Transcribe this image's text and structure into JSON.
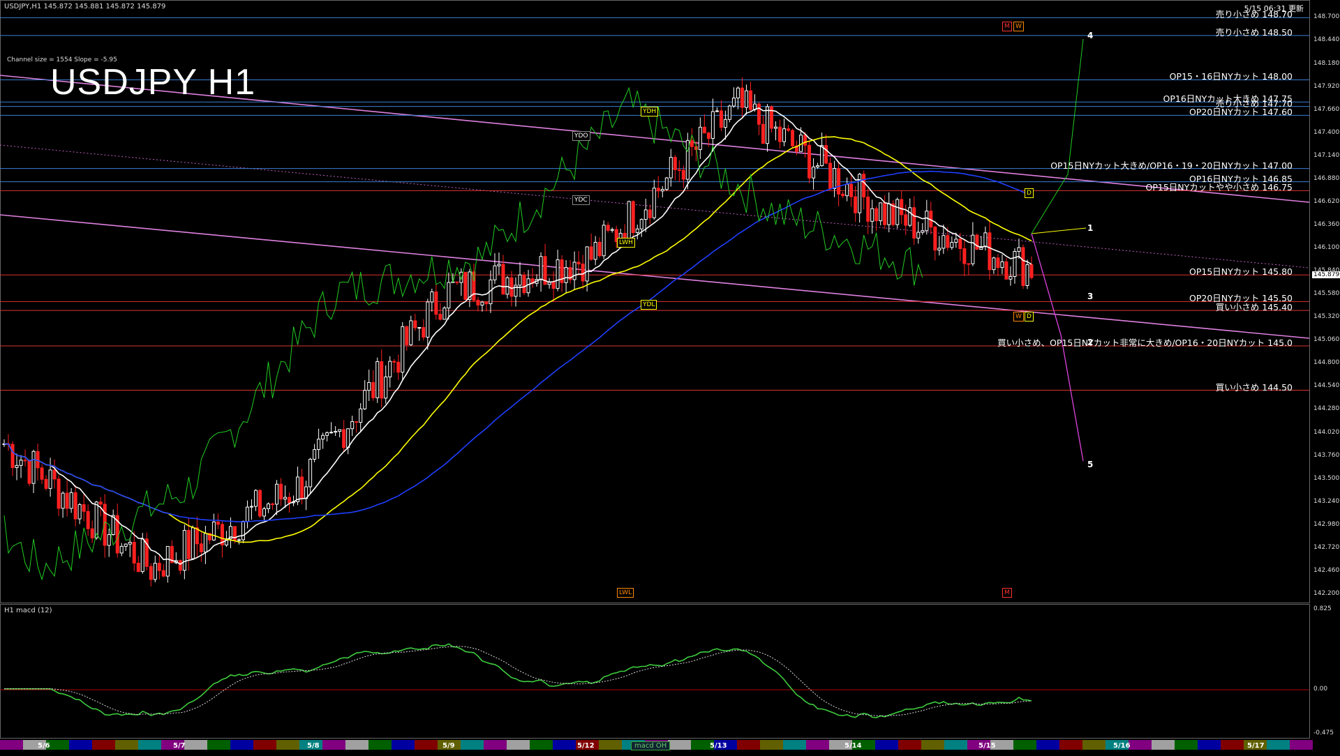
{
  "header": {
    "symbol_info": "USDJPY,H1  145.872 145.881 145.872 145.879",
    "channel_info": "Channel size = 1554 Slope = -5.95",
    "big_title": "USDJPY H1",
    "updated": "5/15 06:31 更新",
    "current_price": "145.879"
  },
  "macd_panel": {
    "label": "H1  macd (12)",
    "button": "macd OH",
    "scale": [
      "0.825",
      "0.00",
      "-0.475"
    ],
    "zero": "0.00"
  },
  "dates": [
    "5/6",
    "5/7",
    "5/8",
    "5/9",
    "5/12",
    "5/13",
    "5/14",
    "5/15",
    "5/16",
    "5/17"
  ],
  "price_scale": [
    "148.700",
    "148.440",
    "148.180",
    "147.920",
    "147.660",
    "147.400",
    "147.140",
    "146.880",
    "146.620",
    "146.360",
    "146.100",
    "145.840",
    "145.580",
    "145.320",
    "145.060",
    "144.800",
    "144.540",
    "144.280",
    "144.020",
    "143.760",
    "143.500",
    "143.240",
    "142.980",
    "142.720",
    "142.460",
    "142.200"
  ],
  "levels": [
    {
      "text": "売り小さめ 148.70",
      "price": 148.7,
      "color": "#3b7fd6"
    },
    {
      "text": "売り小さめ 148.50",
      "price": 148.5,
      "color": "#3b7fd6"
    },
    {
      "text": "OP15・16日NYカット 148.00",
      "price": 148.0,
      "color": "#3b7fd6"
    },
    {
      "text": "OP16日NYカット大きめ 147.75",
      "price": 147.75,
      "color": "#3b7fd6"
    },
    {
      "text": "売り小さめ 147.70",
      "price": 147.7,
      "color": "#3b7fd6"
    },
    {
      "text": "OP20日NYカット 147.60",
      "price": 147.6,
      "color": "#3b7fd6"
    },
    {
      "text": "OP15日NYカット大きめ/OP16・19・20日NYカット 147.00",
      "price": 147.0,
      "color": "#3b7fd6"
    },
    {
      "text": "OP16日NYカット 146.85",
      "price": 146.85,
      "color": "#3b7fd6"
    },
    {
      "text": "OP15日NYカットやや小さめ 146.75",
      "price": 146.75,
      "color": "#d33"
    },
    {
      "text": "OP15日NYカット 145.80",
      "price": 145.8,
      "color": "#d33"
    },
    {
      "text": "OP20日NYカット 145.50",
      "price": 145.5,
      "color": "#d33"
    },
    {
      "text": "買い小さめ 145.40",
      "price": 145.4,
      "color": "#d33"
    },
    {
      "text": "買い小さめ、OP15日NYカット非常に大きめ/OP16・20日NYカット 145.0",
      "price": 145.0,
      "color": "#d33"
    },
    {
      "text": "買い小さめ 144.50",
      "price": 144.5,
      "color": "#d33"
    }
  ],
  "tags": {
    "ydh": "YDH",
    "ydo": "YDO",
    "ydc": "YDC",
    "lwh": "LWH",
    "ydl": "YDL",
    "lwl": "LWL",
    "m1": "M",
    "w1": "W",
    "w2": "W",
    "d1": "D",
    "d2": "D",
    "m2": "M"
  },
  "waves": [
    "1",
    "2",
    "3",
    "4",
    "5"
  ],
  "chart_data": {
    "type": "line",
    "title": "USDJPY H1",
    "x": [
      "5/6",
      "5/7",
      "5/8",
      "5/9",
      "5/12",
      "5/13",
      "5/14",
      "5/15"
    ],
    "series": [
      {
        "name": "",
        "values": [
          143.9,
          142.5,
          143.4,
          145.6,
          146.0,
          147.7,
          146.5,
          145.88
        ]
      }
    ],
    "ylim": [
      142.2,
      148.9
    ],
    "grid": false,
    "colors": {
      "up": "#ffffff",
      "down": "#ff2020",
      "ma_white": "#ffffff",
      "ma_yellow": "#ffff00",
      "ma_blue": "#1f3fff",
      "chikou": "#22cc22",
      "macd": "#3dcc3d",
      "macd_down": "#ff7f9f"
    }
  }
}
